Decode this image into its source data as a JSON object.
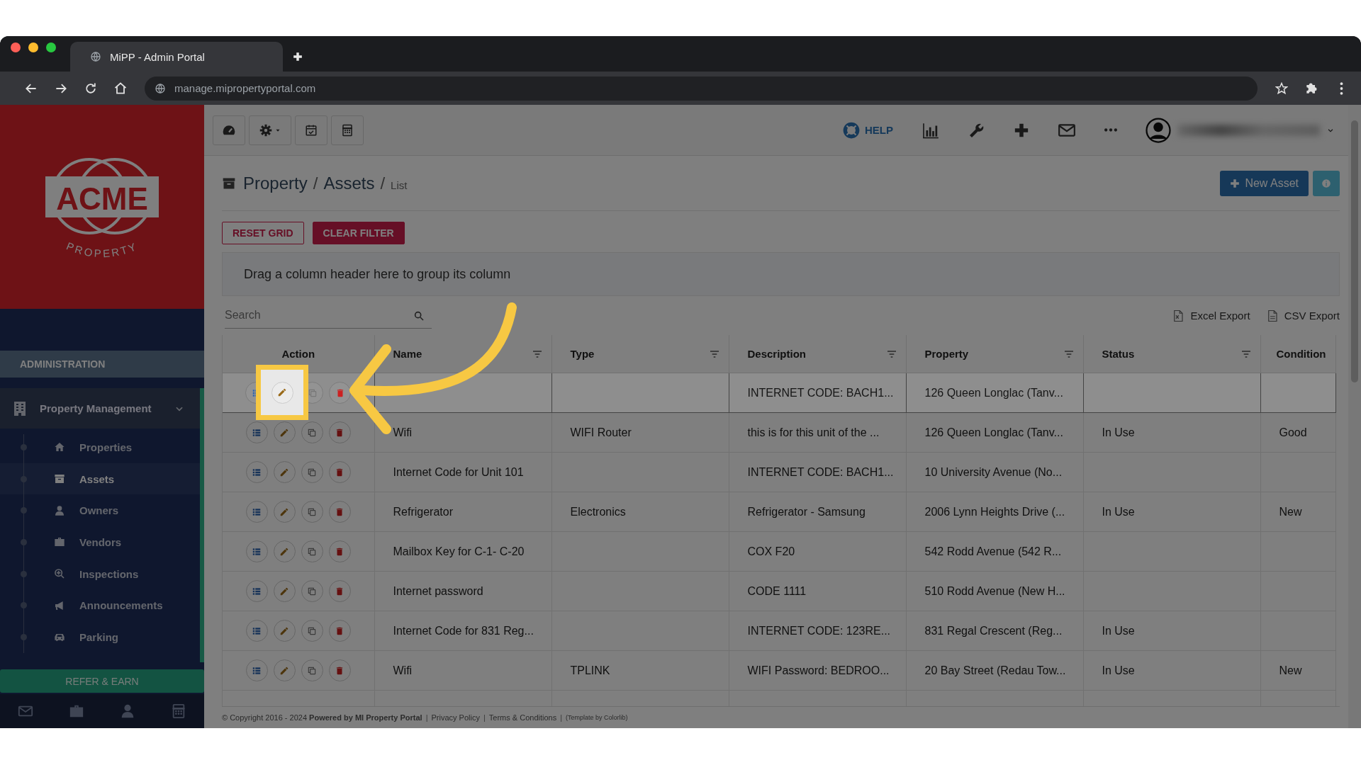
{
  "browser": {
    "tab_title": "MiPP - Admin Portal",
    "url": "manage.mipropertyportal.com"
  },
  "logo": {
    "name": "ACME",
    "tagline": "PROPERTY"
  },
  "sidebar": {
    "section": "ADMINISTRATION",
    "group": {
      "label": "Property Management",
      "expanded": true
    },
    "items": [
      {
        "label": "Properties",
        "selected": false
      },
      {
        "label": "Assets",
        "selected": true
      },
      {
        "label": "Owners",
        "selected": false
      },
      {
        "label": "Vendors",
        "selected": false
      },
      {
        "label": "Inspections",
        "selected": false
      },
      {
        "label": "Announcements",
        "selected": false
      },
      {
        "label": "Parking",
        "selected": false
      }
    ],
    "refer_button": "REFER & EARN"
  },
  "header": {
    "help": "HELP"
  },
  "breadcrumb": [
    "Property",
    "Assets"
  ],
  "breadcrumb_current": "List",
  "breadcrumb_separator": "/",
  "new_asset_button": "New Asset",
  "grid_buttons": [
    {
      "label": "RESET GRID",
      "kind": "outline"
    },
    {
      "label": "CLEAR FILTER",
      "kind": "filled"
    }
  ],
  "group_panel": "Drag a column header here to group its column",
  "search": {
    "placeholder": "Search"
  },
  "exports": [
    {
      "label": "Excel Export",
      "kind": "excel"
    },
    {
      "label": "CSV Export",
      "kind": "csv"
    }
  ],
  "columns": [
    {
      "label": "Action",
      "filter": false
    },
    {
      "label": "Name",
      "filter": true
    },
    {
      "label": "Type",
      "filter": true
    },
    {
      "label": "Description",
      "filter": true
    },
    {
      "label": "Property",
      "filter": true
    },
    {
      "label": "Status",
      "filter": true
    },
    {
      "label": "Condition",
      "filter": false
    }
  ],
  "rows": [
    {
      "description": "INTERNET CODE: BACH1...",
      "property": "126 Queen Longlac (Tanv...",
      "selected": true,
      "spotlight": true
    },
    {
      "name": "Wifi",
      "type": "WIFI Router",
      "description": "this is for this unit of the ...",
      "property": "126 Queen Longlac (Tanv...",
      "status": "In Use",
      "condition": "Good",
      "selected": false,
      "spotlight": false
    },
    {
      "name": "Internet Code for Unit 101",
      "description": "INTERNET CODE: BACH1...",
      "property": "10 University Avenue (No...",
      "selected": false,
      "spotlight": false
    },
    {
      "name": "Refrigerator",
      "type": "Electronics",
      "description": "Refrigerator - Samsung",
      "property": "2006 Lynn Heights Drive (...",
      "status": "In Use",
      "condition": "New",
      "selected": false,
      "spotlight": false
    },
    {
      "name": "Mailbox Key for C-1- C-20",
      "description": "COX F20",
      "property": "542 Rodd Avenue (542 R...",
      "selected": false,
      "spotlight": false
    },
    {
      "name": "Internet password",
      "description": "CODE 1111",
      "property": "510 Rodd Avenue (New H...",
      "selected": false,
      "spotlight": false
    },
    {
      "name": "Internet Code for 831 Reg...",
      "description": "INTERNET CODE: 123RE...",
      "property": "831 Regal Crescent (Reg...",
      "status": "In Use",
      "selected": false,
      "spotlight": false
    },
    {
      "name": "Wifi",
      "type": "TPLINK",
      "description": "WIFI Password: BEDROO...",
      "property": "20 Bay Street (Redau Tow...",
      "status": "In Use",
      "condition": "New",
      "selected": false,
      "spotlight": false
    }
  ],
  "footer": {
    "copyright": "© Copyright 2016 - 2024 **Powered by MI Property Portal**",
    "separator": "|",
    "links": [
      "Privacy Policy",
      "Terms & Conditions"
    ],
    "credit": "(Template by Colorlib)"
  }
}
